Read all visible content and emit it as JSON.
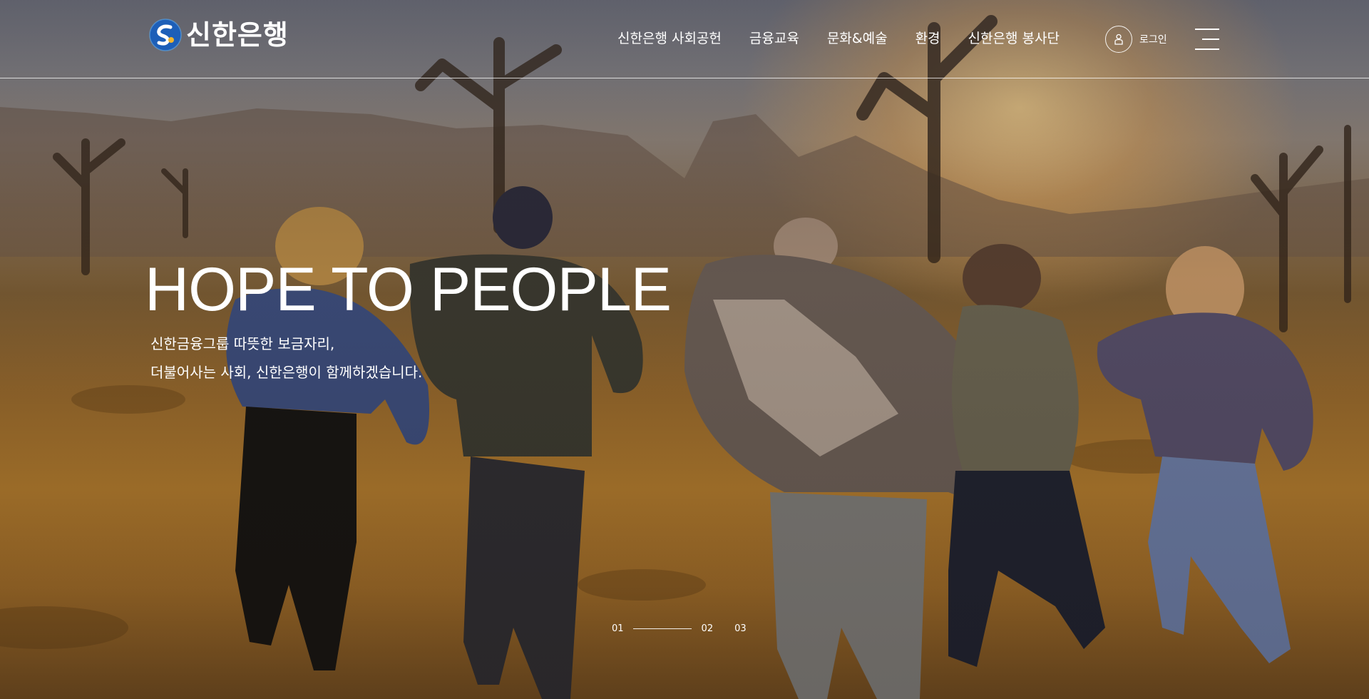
{
  "brand": {
    "name": "신한은행",
    "logo_icon": "shinhan-logo-icon"
  },
  "nav": {
    "items": [
      {
        "label": "신한은행 사회공헌"
      },
      {
        "label": "금융교육"
      },
      {
        "label": "문화&예술"
      },
      {
        "label": "환경"
      },
      {
        "label": "신한은행 봉사단"
      }
    ]
  },
  "login": {
    "label": "로그인",
    "icon": "user-icon"
  },
  "menu": {
    "icon": "hamburger-menu-icon"
  },
  "hero": {
    "headline": "HOPE TO PEOPLE",
    "sublines": [
      "신한금융그룹 따뜻한 보금자리,",
      "더불어사는 사회, 신한은행이 함께하겠습니다."
    ]
  },
  "pager": {
    "slides": [
      "01",
      "02",
      "03"
    ],
    "active": "01"
  },
  "colors": {
    "text": "#ffffff",
    "logo_blue": "#1d5fb8"
  }
}
